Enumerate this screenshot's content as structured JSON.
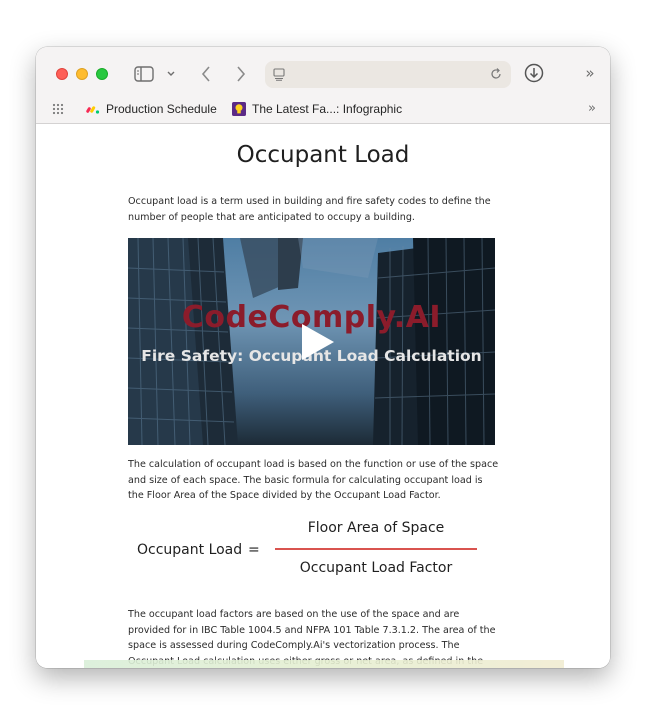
{
  "browser": {
    "bookmarks": [
      {
        "label": "Production Schedule",
        "icon": "monday-logo-icon"
      },
      {
        "label": "The Latest Fa...: Infographic",
        "icon": "lightbulb-icon"
      }
    ],
    "more_label": "»",
    "bookmarks_more_label": "»"
  },
  "page": {
    "title": "Occupant Load",
    "intro": "Occupant load is a term used in building and fire safety codes to define the number of people that are anticipated to occupy a building.",
    "video": {
      "brand": "CodeComply.AI",
      "subtitle": "Fire Safety: Occupant Load Calculation"
    },
    "calc_text": "The calculation of occupant load is based on the function or use of the space and size of each space. The basic formula for calculating occupant load is the Floor Area of the Space divided by the Occupant Load Factor.",
    "formula": {
      "label": "Occupant Load",
      "equals": "=",
      "numerator": "Floor Area of Space",
      "denominator": "Occupant Load  Factor"
    },
    "factors_text": "The occupant load factors are based on the use of the space and are provided for in IBC Table 1004.5 and NFPA 101 Table 7.3.1.2. The area of the space is assessed during CodeComply.Ai's vectorization process. The Occupant Load calculation uses either gross or net area, as defined in the IBC"
  },
  "colors": {
    "formula_line": "#d9534f",
    "brand": "#8b1c2b"
  }
}
